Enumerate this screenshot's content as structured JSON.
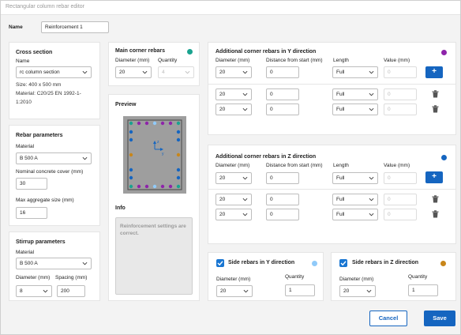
{
  "window": {
    "title": "Rectangular column rebar editor"
  },
  "name": {
    "label": "Name",
    "value": "Reinforcement 1"
  },
  "cross_section": {
    "title": "Cross section",
    "name_label": "Name",
    "name_value": "rc column section",
    "size": "Size: 400 x 500 mm",
    "material_line1": "Material: C20/25 EN 1992-1-",
    "material_line2": "1:2010"
  },
  "rebar_parameters": {
    "title": "Rebar parameters",
    "material_label": "Material",
    "material_value": "B 500 A",
    "cover_label": "Nominal concrete cover (mm)",
    "cover_value": "30",
    "aggregate_label": "Max aggregate size (mm)",
    "aggregate_value": "16"
  },
  "stirrup_parameters": {
    "title": "Stirrup parameters",
    "material_label": "Material",
    "material_value": "B 500 A",
    "diameter_label": "Diameter (mm)",
    "diameter_value": "8",
    "spacing_label": "Spacing (mm)",
    "spacing_value": "200"
  },
  "main_corner": {
    "title": "Main corner rebars",
    "color": "#1aa38f",
    "diameter_label": "Diameter (mm)",
    "diameter_value": "20",
    "quantity_label": "Quantity",
    "quantity_value": "4"
  },
  "preview": {
    "title": "Preview",
    "axis_z": "z",
    "axis_y": "y"
  },
  "info": {
    "title": "Info",
    "message": "Reinforcement settings are correct."
  },
  "add_y": {
    "title": "Additional corner rebars in Y direction",
    "color": "#8e24aa",
    "col_diameter": "Diameter (mm)",
    "col_distance": "Distance from start (mm)",
    "col_length": "Length",
    "col_value": "Value (mm)",
    "add_label": "+",
    "rows": [
      {
        "diameter": "20",
        "distance": "0",
        "length": "Full",
        "value": "0"
      },
      {
        "diameter": "20",
        "distance": "0",
        "length": "Full",
        "value": "0"
      },
      {
        "diameter": "20",
        "distance": "0",
        "length": "Full",
        "value": "0"
      }
    ]
  },
  "add_z": {
    "title": "Additional corner rebars in Z direction",
    "color": "#1565c0",
    "col_diameter": "Diameter (mm)",
    "col_distance": "Distance from start (mm)",
    "col_length": "Length",
    "col_value": "Value (mm)",
    "add_label": "+",
    "rows": [
      {
        "diameter": "20",
        "distance": "0",
        "length": "Full",
        "value": "0"
      },
      {
        "diameter": "20",
        "distance": "0",
        "length": "Full",
        "value": "0"
      },
      {
        "diameter": "20",
        "distance": "0",
        "length": "Full",
        "value": "0"
      }
    ]
  },
  "side_y": {
    "title": "Side rebars in Y direction",
    "color": "#90caf9",
    "diameter_label": "Diameter (mm)",
    "diameter_value": "20",
    "quantity_label": "Quantity",
    "quantity_value": "1"
  },
  "side_z": {
    "title": "Side rebars in Z direction",
    "color": "#c8861a",
    "diameter_label": "Diameter (mm)",
    "diameter_value": "20",
    "quantity_label": "Quantity",
    "quantity_value": "1"
  },
  "footer": {
    "cancel_label": "Cancel",
    "save_label": "Save"
  }
}
